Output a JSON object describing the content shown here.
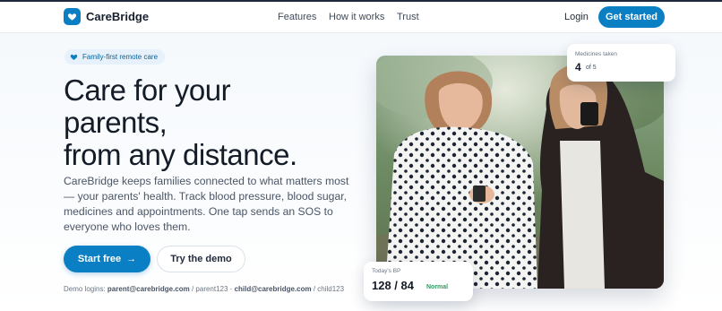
{
  "nav": {
    "brand": "CareBridge",
    "links": [
      "Features",
      "How it works",
      "Trust"
    ],
    "login": "Login",
    "cta": "Get started"
  },
  "hero": {
    "badge": "Family-first remote care",
    "title_lines": [
      "Care for your",
      "parents,",
      "from any distance."
    ],
    "lede": "CareBridge keeps families connected to what matters most — your parents' health. Track blood pressure, blood sugar, medicines and appointments. One tap sends an SOS to everyone who loves them.",
    "primary_button": "Start free",
    "primary_arrow": "→",
    "secondary_button": "Try the demo",
    "demo": {
      "prefix": "Demo logins:",
      "parent_email": "parent@carebridge.com",
      "parent_sep": " / parent123 · ",
      "child_email": "child@carebridge.com",
      "child_sep": " / child123"
    }
  },
  "cards": {
    "medicines": {
      "label": "Medicines taken",
      "value": "4",
      "of": "of 5"
    },
    "bp": {
      "label": "Today's BP",
      "value": "128 / 84",
      "status": "Normal"
    }
  },
  "colors": {
    "accent": "#0b7fc3",
    "text_dark": "#141c28",
    "status_good": "#2e9a62",
    "badge_bg": "#e6f1fb"
  },
  "icons": {
    "logo": "heart-shield-icon",
    "badge": "heart-icon",
    "arrow": "arrow-right-icon"
  }
}
